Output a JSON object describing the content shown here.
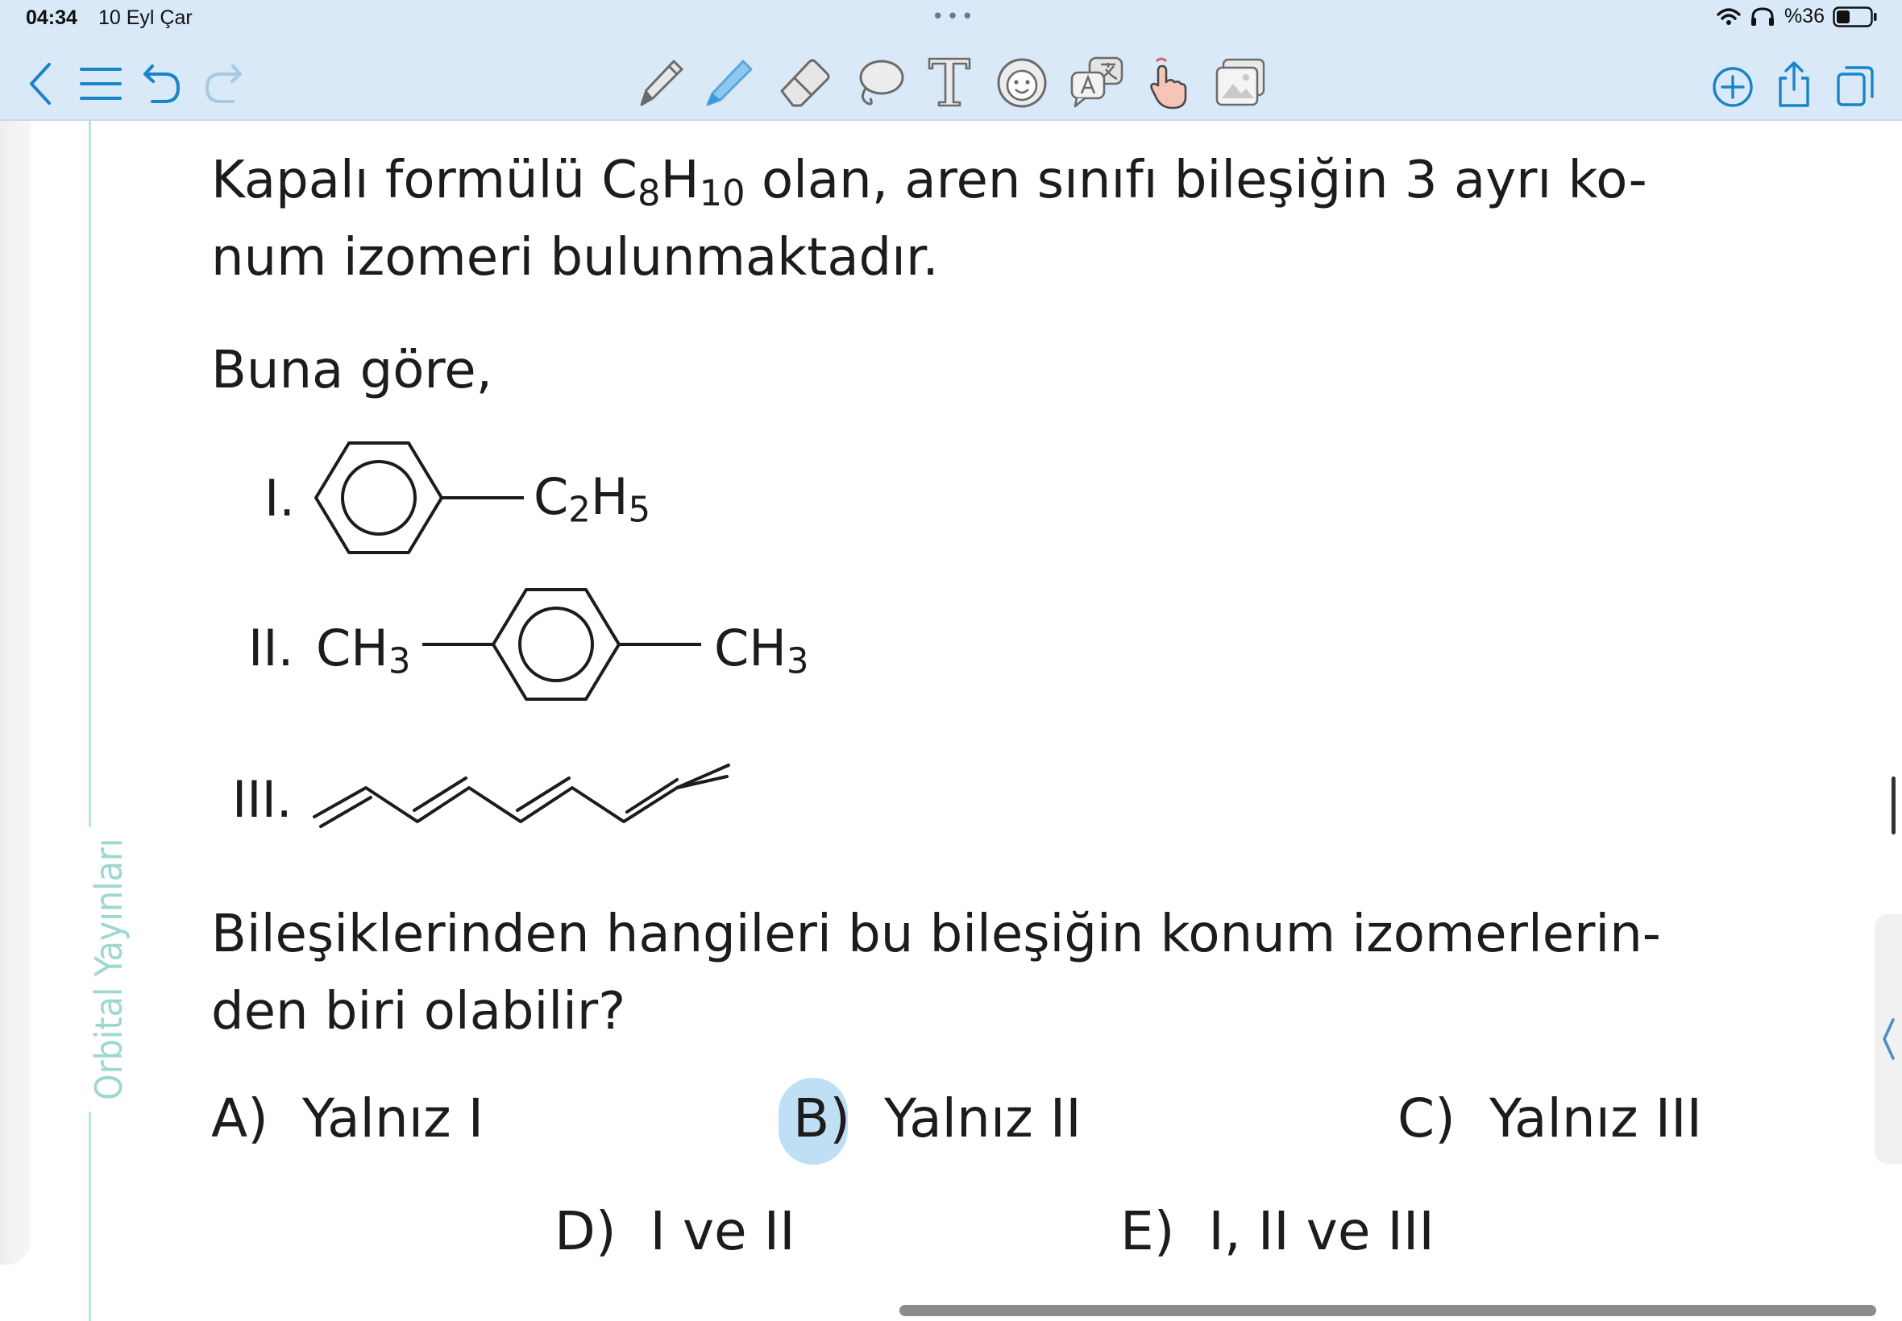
{
  "status_bar": {
    "time": "04:34",
    "date": "10 Eyl Çar",
    "battery": "%36"
  },
  "toolbar": {
    "left_icons": [
      "chevron-left-icon",
      "list-icon",
      "undo-icon",
      "redo-icon"
    ],
    "tool_icons": [
      "pencil-icon",
      "highlighter-icon",
      "eraser-icon",
      "lasso-icon",
      "text-tool-icon",
      "sticker-icon",
      "translate-icon",
      "pointer-hand-icon",
      "image-icon"
    ],
    "right_icons": [
      "add-icon",
      "share-icon",
      "pages-icon"
    ],
    "accent_color": "#1a84c9"
  },
  "page": {
    "watermark": "Orbital Yayınları",
    "question_line1_a": "Kapalı formülü C",
    "question_line1_sub1": "8",
    "question_line1_b": "H",
    "question_line1_sub2": "10",
    "question_line1_c": " olan, aren sınıfı bileşiğin 3 ayrı ko-",
    "question_line2": "num izomeri bulunmaktadır.",
    "lead": "Buna göre,",
    "compounds": {
      "I": {
        "label": "I.",
        "group": "C",
        "sub1": "2",
        "group2": "H",
        "sub2": "5"
      },
      "II": {
        "label": "II.",
        "left": "CH",
        "left_sub": "3",
        "right": "CH",
        "right_sub": "3"
      },
      "III": {
        "label": "III."
      }
    },
    "question_line3": "Bileşiklerinden hangileri bu bileşiğin konum izomerlerin-",
    "question_line4": "den biri olabilir?",
    "options": {
      "A": {
        "letter": "A)",
        "text": "Yalnız I"
      },
      "B": {
        "letter": "B)",
        "text": "Yalnız II",
        "highlighted": true,
        "highlight_color": "#b8dcf4"
      },
      "C": {
        "letter": "C)",
        "text": "Yalnız III"
      },
      "D": {
        "letter": "D)",
        "text": "I ve II"
      },
      "E": {
        "letter": "E)",
        "text": "I, II ve III"
      }
    }
  }
}
